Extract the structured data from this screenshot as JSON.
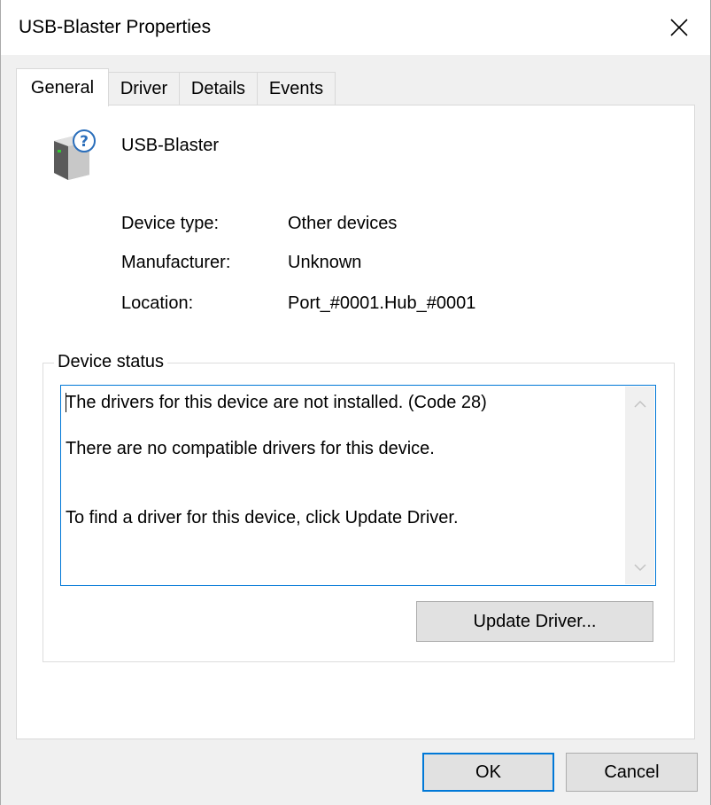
{
  "window": {
    "title": "USB-Blaster Properties"
  },
  "tabs": [
    {
      "label": "General",
      "active": true
    },
    {
      "label": "Driver",
      "active": false
    },
    {
      "label": "Details",
      "active": false
    },
    {
      "label": "Events",
      "active": false
    }
  ],
  "device": {
    "name": "USB-Blaster",
    "icon": "unknown-device-icon",
    "properties": [
      {
        "label": "Device type:",
        "value": "Other devices"
      },
      {
        "label": "Manufacturer:",
        "value": "Unknown"
      },
      {
        "label": "Location:",
        "value": "Port_#0001.Hub_#0001"
      }
    ]
  },
  "status": {
    "legend": "Device status",
    "lines": [
      "The drivers for this device are not installed. (Code 28)",
      "There are no compatible drivers for this device.",
      "To find a driver for this device, click Update Driver."
    ],
    "update_button": "Update Driver..."
  },
  "footer": {
    "ok_label": "OK",
    "cancel_label": "Cancel"
  },
  "colors": {
    "accent": "#0078d7",
    "window_bg": "#f0f0f0",
    "panel_bg": "#ffffff",
    "button_bg": "#e1e1e1"
  }
}
